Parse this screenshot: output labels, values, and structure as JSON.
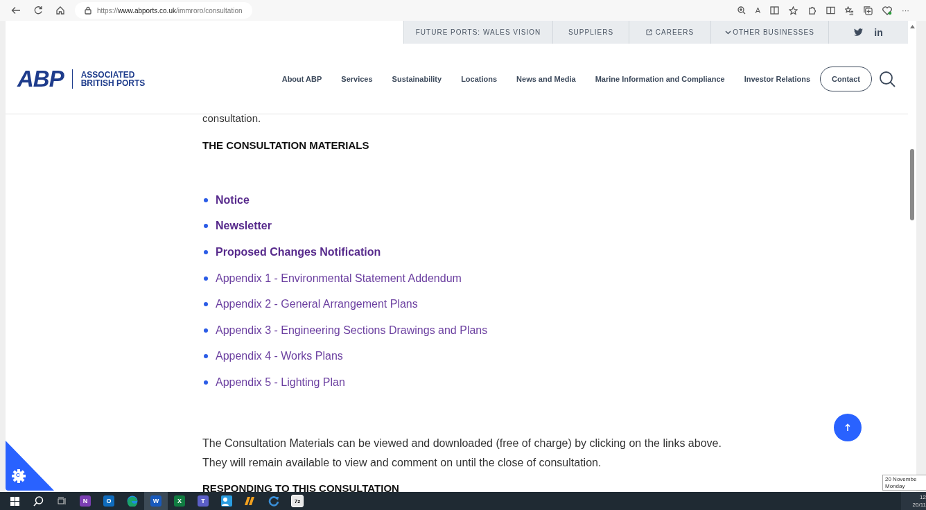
{
  "browser": {
    "url_host": "https://www.abports.co.uk",
    "url_path": "/immroro/consultation",
    "read_aloud": "A",
    "more": "···"
  },
  "utility_nav": [
    {
      "label": "FUTURE PORTS: WALES VISION",
      "kind": "plain"
    },
    {
      "label": "SUPPLIERS",
      "kind": "plain"
    },
    {
      "label": "CAREERS",
      "kind": "external"
    },
    {
      "label": "OTHER BUSINESSES",
      "kind": "dropdown"
    }
  ],
  "social": {
    "linkedin": "in"
  },
  "brand": {
    "logo": "ABP",
    "line_1": "ASSOCIATED",
    "line_2": "BRITISH PORTS"
  },
  "main_nav": [
    "About ABP",
    "Services",
    "Sustainability",
    "Locations",
    "News and Media",
    "Marine Information and Compliance",
    "Investor Relations"
  ],
  "contact": "Contact",
  "content": {
    "lead_in": "consultation.",
    "heading": "THE CONSULTATION MATERIALS",
    "materials": [
      {
        "label": "Notice",
        "emphasis": true
      },
      {
        "label": "Newsletter",
        "emphasis": true
      },
      {
        "label": "Proposed Changes Notification",
        "emphasis": true
      },
      {
        "label": "Appendix 1 - Environmental Statement Addendum",
        "emphasis": false
      },
      {
        "label": "Appendix 2 - General Arrangement Plans",
        "emphasis": false
      },
      {
        "label": "Appendix 3 - Engineering Sections Drawings and Plans",
        "emphasis": false
      },
      {
        "label": "Appendix 4 - Works Plans",
        "emphasis": false
      },
      {
        "label": "Appendix 5 - Lighting Plan",
        "emphasis": false
      }
    ],
    "paragraph": [
      "The Consultation Materials can be viewed and downloaded (free of charge) by clicking on the links above.",
      "They will remain available to view and comment on until the close of consultation."
    ],
    "next_heading": "RESPONDING TO THIS CONSULTATION"
  },
  "cookie_badge": "C",
  "taskbar": {
    "apps": [
      {
        "kind": "notes",
        "glyph": "N",
        "color": "#7b3fb3",
        "selected": false
      },
      {
        "kind": "mail",
        "glyph": "O",
        "color": "#0f6cbd",
        "selected": false
      },
      {
        "kind": "browser",
        "color": "#1aa36b",
        "selected": false
      },
      {
        "kind": "doc",
        "glyph": "W",
        "color": "#185abd",
        "selected": true
      },
      {
        "kind": "sheet",
        "glyph": "X",
        "color": "#107c41",
        "selected": false
      },
      {
        "kind": "team",
        "glyph": "T",
        "color": "#5b5fc7",
        "selected": false
      },
      {
        "kind": "people",
        "color": "#2a9de0",
        "selected": false
      },
      {
        "kind": "bars",
        "color": "#f0a020",
        "selected": false
      },
      {
        "kind": "sync",
        "color": "#3a8fd8",
        "selected": false
      },
      {
        "kind": "archive",
        "glyph": "7z",
        "color": "#e8e8e8",
        "selected": false
      }
    ],
    "clock": {
      "time": "12",
      "date": "20/11"
    },
    "tooltip": {
      "date": "20 Novembe",
      "day": "Monday"
    }
  }
}
